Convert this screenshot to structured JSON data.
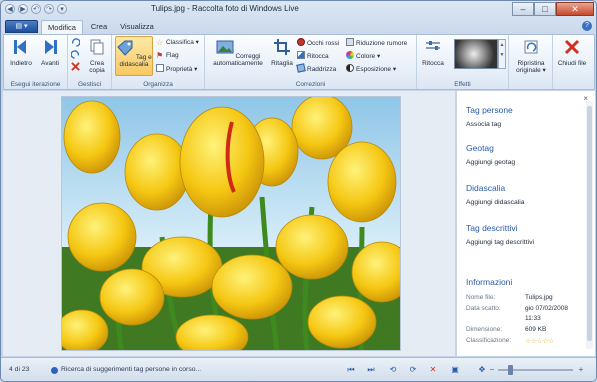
{
  "window": {
    "title": "Tulips.jpg - Raccolta foto di Windows Live",
    "controls": [
      "–",
      "□",
      "✕"
    ]
  },
  "quick_access": [
    "◀",
    "▶",
    "↶",
    "↷",
    "▾"
  ],
  "tabs": {
    "app_button": "▾",
    "items": [
      "Modifica",
      "Crea",
      "Visualizza"
    ],
    "active": "Modifica",
    "help": "?"
  },
  "ribbon": {
    "groups": {
      "iterazione": {
        "label": "Esegui iterazione",
        "back": "Indietro",
        "forward": "Avanti"
      },
      "gestisci": {
        "label": "Gestisci",
        "crea_copia": "Crea copia"
      },
      "organizza": {
        "label": "Organizza",
        "tag": "Tag e didascalia",
        "classifica": "Classifica",
        "flag": "Flag",
        "proprieta": "Proprietà"
      },
      "correzioni": {
        "label": "Correzioni",
        "correggi": "Correggi automaticamente",
        "ritaglia": "Ritaglia",
        "occhi_rossi": "Occhi rossi",
        "ritocca": "Ritocca",
        "raddrizza": "Raddrizza",
        "riduzione": "Riduzione rumore",
        "colore": "Colore",
        "esposizione": "Esposizione"
      },
      "effetti": {
        "label": "Effetti",
        "ritocca": "Ritocca"
      },
      "ripristina": {
        "label": "Ripristina originale"
      },
      "chiudi": {
        "label": "Chiudi file"
      }
    }
  },
  "side_panel": {
    "close": "×",
    "tag_persone": {
      "heading": "Tag persone",
      "item": "Associa tag"
    },
    "geotag": {
      "heading": "Geotag",
      "item": "Aggiungi geotag"
    },
    "didascalia": {
      "heading": "Didascalia",
      "item": "Aggiungi didascalia"
    },
    "tag_descrittivi": {
      "heading": "Tag descrittivi",
      "item": "Aggiungi tag descrittivi"
    },
    "informazioni": {
      "heading": "Informazioni",
      "rows": [
        {
          "label": "Nome file:",
          "value": "Tulips.jpg"
        },
        {
          "label": "Data scatto:",
          "value": "gio 07/02/2008"
        },
        {
          "label": "",
          "value": "11:33"
        },
        {
          "label": "Dimensione:",
          "value": "609 KB"
        },
        {
          "label": "Classificazione:",
          "value": "☆☆☆☆☆"
        }
      ]
    }
  },
  "status": {
    "count": "4 di 23",
    "message": "Ricerca di suggerimenti tag persone in corso...",
    "nav_icons": [
      "⏮",
      "⏭",
      "⟲",
      "⟳",
      "✕",
      "▣",
      "✥"
    ],
    "zoom_out": "−",
    "zoom_in": "+"
  },
  "colors": {
    "accent": "#2b5aa8",
    "ribbon_bg": "#e6eef8",
    "selected": "#f8c862",
    "close_red": "#c5492c"
  }
}
